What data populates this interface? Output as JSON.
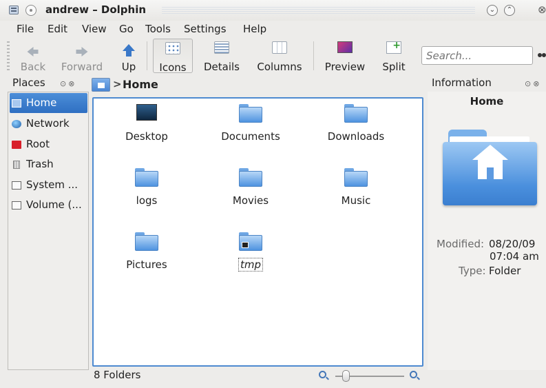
{
  "window": {
    "title": "andrew – Dolphin"
  },
  "menu": {
    "file": "File",
    "edit": "Edit",
    "view": "View",
    "go": "Go",
    "tools": "Tools",
    "settings": "Settings",
    "help": "Help"
  },
  "toolbar": {
    "back": "Back",
    "forward": "Forward",
    "up": "Up",
    "icons": "Icons",
    "details": "Details",
    "columns": "Columns",
    "preview": "Preview",
    "split": "Split",
    "search_placeholder": "Search..."
  },
  "places": {
    "title": "Places",
    "items": [
      {
        "label": "Home",
        "icon": "home-icon"
      },
      {
        "label": "Network",
        "icon": "network-icon"
      },
      {
        "label": "Root",
        "icon": "root-folder-icon"
      },
      {
        "label": "Trash",
        "icon": "trash-icon"
      },
      {
        "label": "System ...",
        "icon": "drive-icon"
      },
      {
        "label": "Volume (...",
        "icon": "drive-icon"
      }
    ]
  },
  "breadcrumb": {
    "separator": ">",
    "current": "Home"
  },
  "files": [
    {
      "name": "Desktop",
      "icon": "desktop-icon"
    },
    {
      "name": "Documents",
      "icon": "folder-icon"
    },
    {
      "name": "Downloads",
      "icon": "folder-icon"
    },
    {
      "name": "logs",
      "icon": "folder-icon"
    },
    {
      "name": "Movies",
      "icon": "folder-icon"
    },
    {
      "name": "Music",
      "icon": "folder-icon"
    },
    {
      "name": "Pictures",
      "icon": "folder-icon"
    },
    {
      "name": "tmp",
      "icon": "folder-link-icon"
    }
  ],
  "statusbar": {
    "text": "8 Folders"
  },
  "info": {
    "title": "Information",
    "name": "Home",
    "modified_label": "Modified:",
    "modified_date": "08/20/09",
    "modified_time": "07:04 am",
    "type_label": "Type:",
    "type_value": "Folder"
  },
  "colors": {
    "accent": "#2f6fc2",
    "view_border": "#4d8ad0",
    "folder": "#4f93e0"
  }
}
